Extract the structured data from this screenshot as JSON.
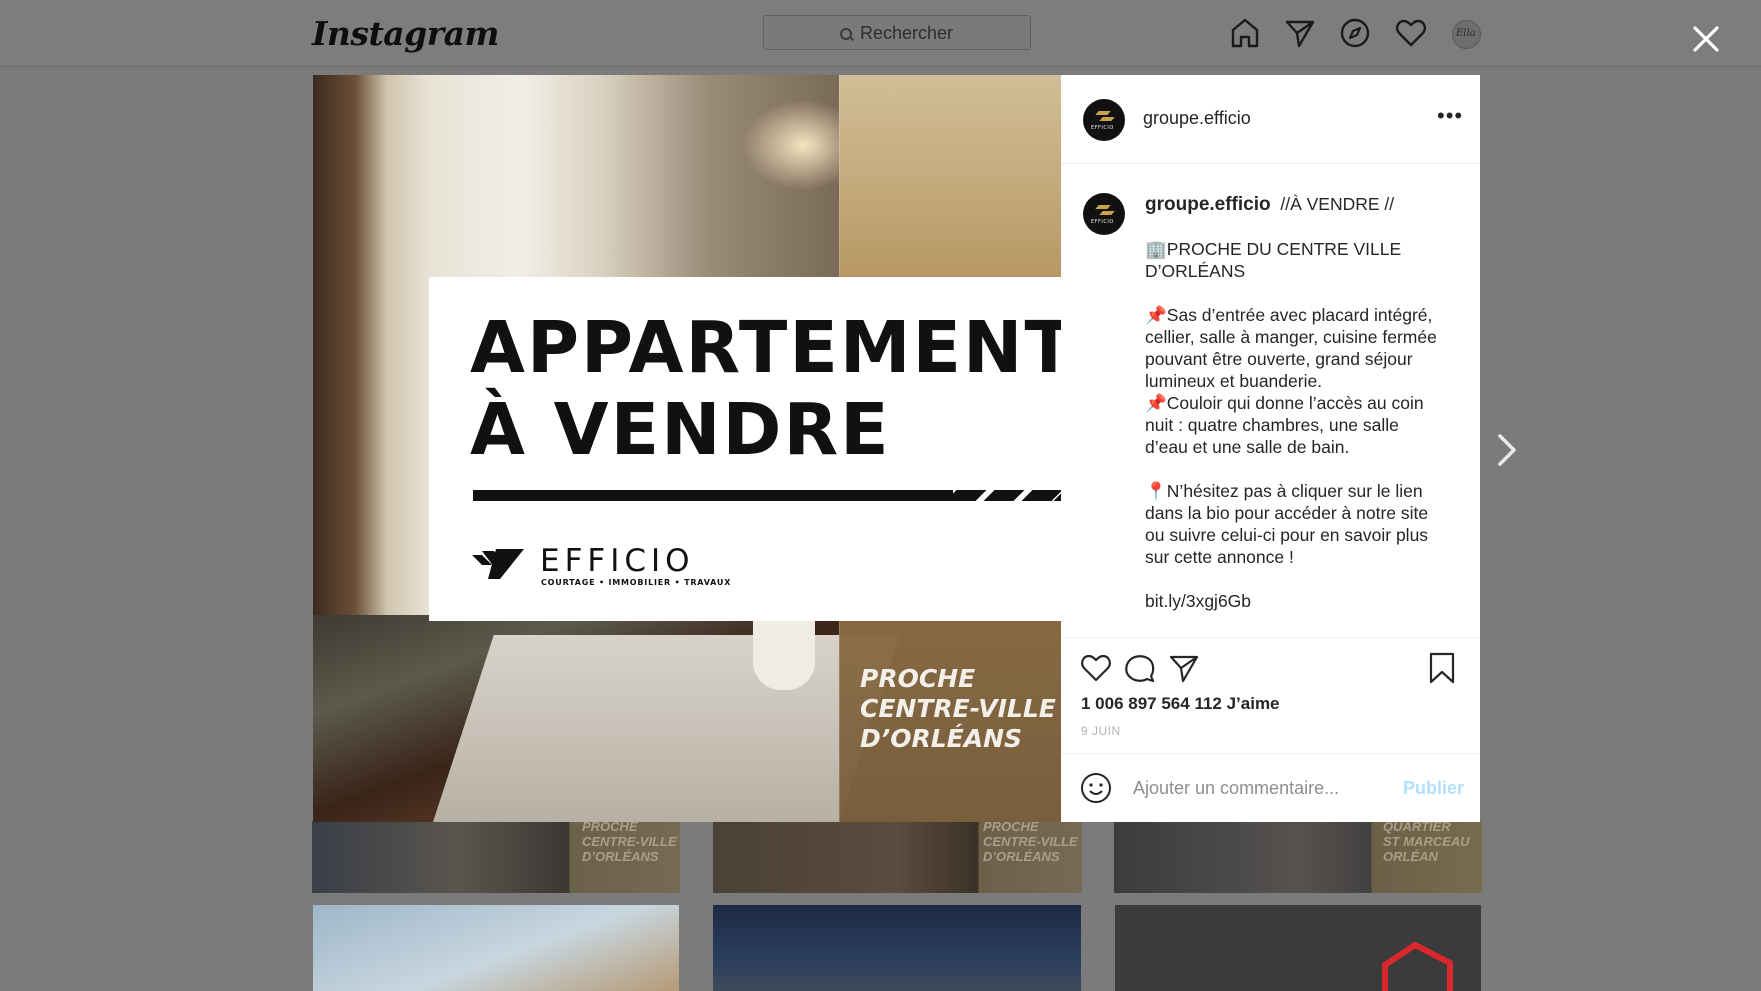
{
  "header": {
    "logo": "Instagram",
    "search_placeholder": "Rechercher",
    "nav_icons": [
      "home-icon",
      "direct-icon",
      "explore-icon",
      "activity-icon",
      "profile-avatar"
    ],
    "avatar_text": "Ella"
  },
  "grid": {
    "tiles": [
      {
        "caption": "PROCHE\nCENTRE-VILLE\nD’ORLÉANS"
      },
      {
        "caption": "PROCHE\nCENTRE-VILLE\nD’ORLÉANS"
      },
      {
        "caption": "QUARTIER\nST MARCEAU\nORLÉAN"
      }
    ]
  },
  "post": {
    "image": {
      "headline_1": "APPARTEMENT",
      "headline_2": "À VENDRE",
      "brand_name": "EFFICIO",
      "brand_tagline": "COURTAGE • IMMOBILIER • TRAVAUX",
      "overlay_caption": "PROCHE\nCENTRE-VILLE\nD’ORLÉANS"
    },
    "author": {
      "username": "groupe.efficio",
      "avatar_text": "EFFICIO"
    },
    "more_label": "•••",
    "caption": {
      "username": "groupe.efficio",
      "title": "//À VENDRE //",
      "p1": "🏢PROCHE DU CENTRE VILLE D’ORLÉANS",
      "p2": "📌Sas d’entrée avec placard intégré, cellier, salle à manger, cuisine fermée pouvant être ouverte, grand séjour lumineux et buanderie.\n📌Couloir qui donne l’accès au coin nuit : quatre chambres, une salle d’eau et une salle de bain.",
      "p3": "📍N’hésitez pas à cliquer sur le lien dans la bio pour accéder à notre site ou suivre celui-ci pour en savoir plus sur cette annonce !",
      "link": "bit.ly/3xgj6Gb"
    },
    "likes": "1 006 897 564 112 J’aime",
    "date": "9 JUIN",
    "comment_placeholder": "Ajouter un commentaire...",
    "publish_label": "Publier"
  },
  "colors": {
    "overlay_gray": "#7b7b7b",
    "accent_publish": "#b2dffc",
    "brand_gold": "#c9a24a"
  }
}
